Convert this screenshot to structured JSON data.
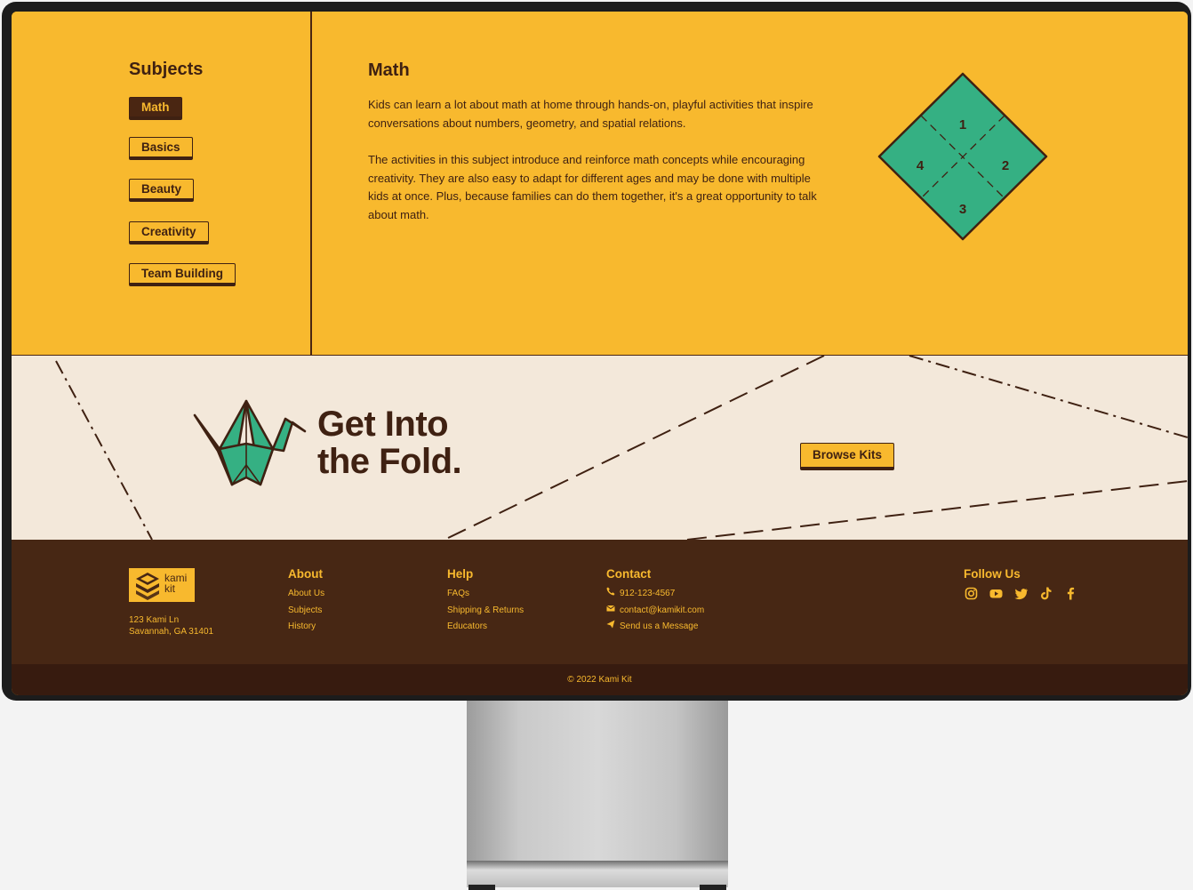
{
  "subjects": {
    "title": "Subjects",
    "items": [
      {
        "label": "Math",
        "active": true
      },
      {
        "label": "Basics",
        "active": false
      },
      {
        "label": "Beauty",
        "active": false
      },
      {
        "label": "Creativity",
        "active": false
      },
      {
        "label": "Team Building",
        "active": false
      }
    ]
  },
  "detail": {
    "title": "Math",
    "paragraphs": [
      "Kids can learn a lot about math at home through hands-on, playful activities that inspire conversations about numbers, geometry, and spatial relations.",
      "The activities in this subject introduce and reinforce math concepts while encouraging creativity. They are also easy to adapt for different ages and may be done with multiple kids at once. Plus, because families can do them together, it's a great opportunity to talk about math."
    ],
    "diamond_labels": [
      "1",
      "2",
      "3",
      "4"
    ]
  },
  "banner": {
    "heading_line1": "Get Into",
    "heading_line2": "the Fold.",
    "button_label": "Browse Kits"
  },
  "footer": {
    "logo_line1": "kami",
    "logo_line2": "kit",
    "address_line1": "123 Kami Ln",
    "address_line2": "Savannah, GA 31401",
    "about": {
      "title": "About",
      "links": [
        "About Us",
        "Subjects",
        "History"
      ]
    },
    "help": {
      "title": "Help",
      "links": [
        "FAQs",
        "Shipping & Returns",
        "Educators"
      ]
    },
    "contact": {
      "title": "Contact",
      "phone": "912-123-4567",
      "email": "contact@kamikit.com",
      "message": "Send us a Message"
    },
    "follow": {
      "title": "Follow Us",
      "icons": [
        "instagram-icon",
        "youtube-icon",
        "twitter-icon",
        "tiktok-icon",
        "facebook-icon"
      ]
    },
    "copyright": "© 2022 Kami Kit"
  },
  "colors": {
    "yellow": "#f8b92e",
    "brown": "#472714",
    "cream": "#f3e8da",
    "green": "#35b083"
  }
}
